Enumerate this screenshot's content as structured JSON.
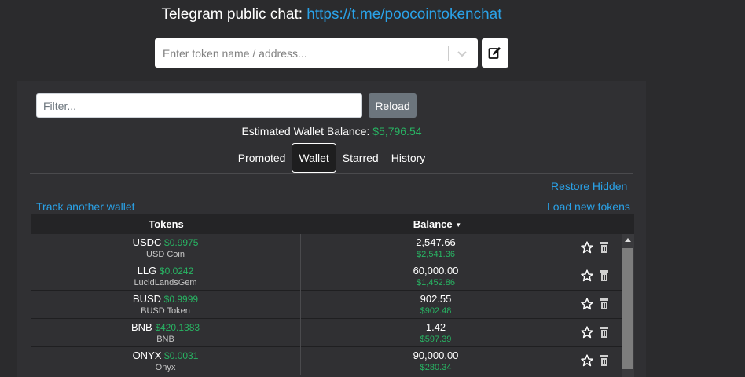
{
  "header": {
    "label": "Telegram public chat: ",
    "link": "https://t.me/poocointokenchat"
  },
  "search": {
    "placeholder": "Enter token name / address..."
  },
  "panel": {
    "filter_placeholder": "Filter...",
    "reload_label": "Reload",
    "wallet_balance_label": "Estimated Wallet Balance: ",
    "wallet_balance_value": "$5,796.54",
    "tabs": [
      {
        "label": "Promoted",
        "active": false
      },
      {
        "label": "Wallet",
        "active": true
      },
      {
        "label": "Starred",
        "active": false
      },
      {
        "label": "History",
        "active": false
      }
    ],
    "restore_hidden": "Restore Hidden",
    "track_another": "Track another wallet",
    "load_new": "Load new tokens"
  },
  "table": {
    "col_tokens": "Tokens",
    "col_balance": "Balance",
    "rows": [
      {
        "symbol": "USDC",
        "price": "$0.9975",
        "name": "USD Coin",
        "amount": "2,547.66",
        "value": "$2,541.36"
      },
      {
        "symbol": "LLG",
        "price": "$0.0242",
        "name": "LucidLandsGem",
        "amount": "60,000.00",
        "value": "$1,452.86"
      },
      {
        "symbol": "BUSD",
        "price": "$0.9999",
        "name": "BUSD Token",
        "amount": "902.55",
        "value": "$902.48"
      },
      {
        "symbol": "BNB",
        "price": "$420.1383",
        "name": "BNB",
        "amount": "1.42",
        "value": "$597.39"
      },
      {
        "symbol": "ONYX",
        "price": "$0.0031",
        "name": "Onyx",
        "amount": "90,000.00",
        "value": "$280.34"
      }
    ]
  },
  "colors": {
    "background": "#2b2b2d",
    "panel": "#303033",
    "link": "#2aa2e8",
    "positive": "#28b463"
  },
  "icons": [
    "chevron-down-icon",
    "edit-icon",
    "star-icon",
    "trash-icon",
    "scroll-up-icon"
  ]
}
